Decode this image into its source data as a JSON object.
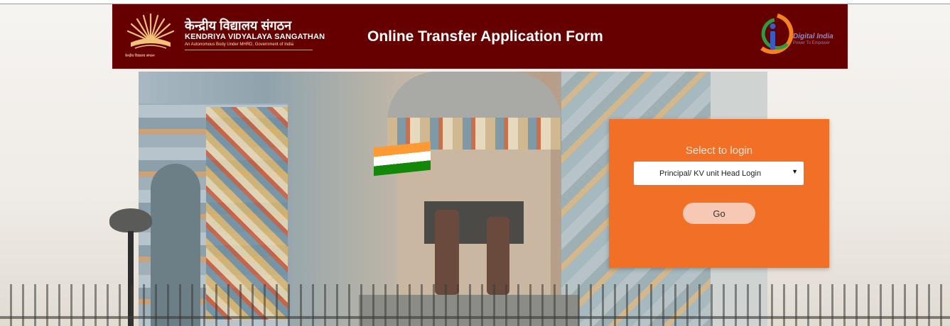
{
  "header": {
    "org_hindi": "केन्द्रीय विद्यालय संगठन",
    "org_english": "KENDRIYA VIDYALAYA SANGATHAN",
    "org_subtitle": "An Autonomous Body Under MHRD, Government of India",
    "logo_small_text": "केन्द्रीय विद्यालय संगठन",
    "title": "Online Transfer Application Form",
    "digital_india": "Digital India",
    "digital_india_tagline": "Power To Empower",
    "bg_color": "#660000"
  },
  "login": {
    "title": "Select to login",
    "selected_option": "Principal/ KV unit Head Login",
    "go_label": "Go",
    "card_color": "#f26f26"
  },
  "icons": {
    "kvs_logo": "kvs-sun-logo-icon",
    "digital_india_logo": "digital-india-logo-icon",
    "dropdown": "chevron-down-icon"
  }
}
